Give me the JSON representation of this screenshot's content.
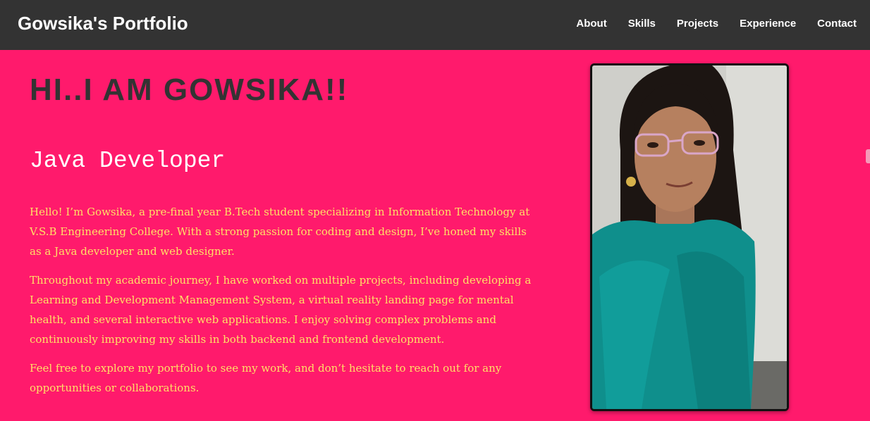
{
  "navbar": {
    "brand": "Gowsika's Portfolio",
    "links": [
      {
        "label": "About"
      },
      {
        "label": "Skills"
      },
      {
        "label": "Projects"
      },
      {
        "label": "Experience"
      },
      {
        "label": "Contact"
      }
    ]
  },
  "hero": {
    "title": "HI..I AM GOWSIKA!!",
    "role": "Java Developer",
    "paragraphs": [
      "Hello! I’m Gowsika, a pre-final year B.Tech student specializing in Information Technology at V.S.B Engineering College. With a strong passion for coding and design, I’ve honed my skills as a Java developer and web designer.",
      "Throughout my academic journey, I have worked on multiple projects, including developing a Learning and Development Management System, a virtual reality landing page for mental health, and several interactive web applications. I enjoy solving complex problems and continuously improving my skills in both backend and frontend development.",
      "Feel free to explore my portfolio to see my work, and don’t hesitate to reach out for any opportunities or collaborations."
    ]
  },
  "colors": {
    "page_background": "#ff1a6c",
    "navbar_background": "#333333",
    "title_color": "#333333",
    "role_color": "#ffffff",
    "bio_color": "#ffe066"
  }
}
